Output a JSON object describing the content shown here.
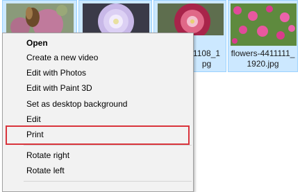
{
  "files": [
    {
      "name_line1": "",
      "name_line2": ""
    },
    {
      "name_line1": "",
      "name_line2": ""
    },
    {
      "name_line1": "1108_1",
      "name_line2": "pg"
    },
    {
      "name_line1": "flowers-4411111_",
      "name_line2": "1920.jpg"
    }
  ],
  "context_menu": {
    "items": [
      {
        "label": "Open",
        "bold": true
      },
      {
        "label": "Create a new video"
      },
      {
        "label": "Edit with Photos"
      },
      {
        "label": "Edit with Paint 3D"
      },
      {
        "label": "Set as desktop background"
      },
      {
        "label": "Edit"
      },
      {
        "label": "Print",
        "highlighted": true
      },
      {
        "label": "Rotate right"
      },
      {
        "label": "Rotate left"
      }
    ]
  },
  "colors": {
    "selection_bg": "#cce8ff",
    "selection_border": "#99d1ff",
    "menu_bg": "#f2f2f2",
    "highlight_border": "#d9343c"
  }
}
